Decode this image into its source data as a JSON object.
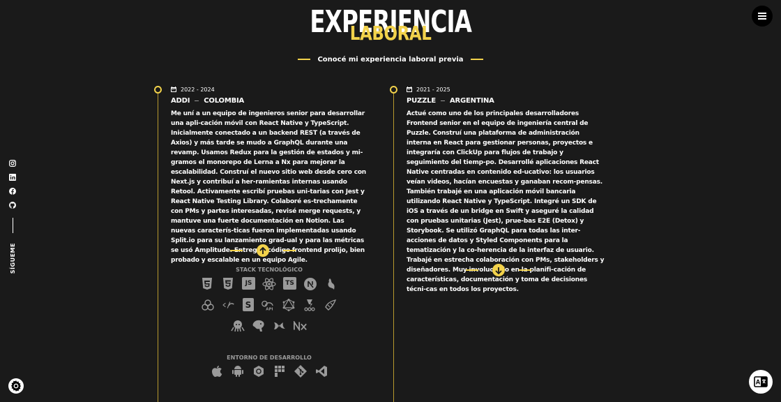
{
  "header": {
    "title": "EXPERIENCIA",
    "title_accent": "LABORAL",
    "subtitle": "Conocé mi experiencia laboral previa"
  },
  "social": {
    "follow_label": "SÍGUEME",
    "icons": [
      "instagram-icon",
      "linkedin-icon",
      "facebook-icon",
      "github-icon"
    ]
  },
  "experiences": [
    {
      "date": "2022 - 2024",
      "company": "ADDI",
      "country": "COLOMBIA",
      "description": "Me uní a un equipo de ingenieros senior para desarrollar una apli-cación móvil con React Native y TypeScript. Inicialmente conectado a un backend REST (a través de Axios) y más tarde se mudo a GraphQL durante una revamp. Usamos Redux para la gestión de estados y mi-gramos el monorepo de Lerna a Nx para mejorar la escalabilidad. Construí el nuevo sitio web desde cero con Next.js y contribuí a her-ramientas internas usando Retool. Activamente escribí pruebas uni-tarias con Jest y React Native Testing Library. Colaboré es-trechamente con PMs y partes interesadas, revisé merge requests, y mantuve una fuerte documentación en Notion. Las nuevas caracterís-ticas fueron implementadas usando Split.io para su lanzamiento grad-ual y para las métricas se usó Amplitude. Entregué código frontend prolijo, bien probado y escalable en un equipo Agile."
    },
    {
      "date": "2021 - 2025",
      "company": "PUZZLE",
      "country": "ARGENTINA",
      "description": "Actué como uno de los principales desarrolladores Frontend senior en el equipo de ingeniería central de Puzzle. Construí una plataforma de administración interna en React para gestionar personas, proyectos e integraría con ClickUp para flujos de trabajo y seguimiento del tiemp-po. Desarrollé aplicaciones React Native centradas en contenido ed-ucativo: los usuarios veían videos, hacían encuestas y ganaban recom-pensas. También trabajé en una aplicación móvil bancaria utilizando React Native y TypeScript. Integré un SDK de iOS a través de un bridge en Swift y aseguré la calidad con pruebas unitarias (Jest), prue-bas E2E (Detox) y Storybook. Se utilizó GraphQL para todas las inter-acciones de datos y Styled Components para la tematización y la co-herencia de la interfaz de usuario. Trabajé en estrecha colaboración con PMs, stakeholders y diseñadores. Muy involucrado en la planifi-cación de características, documentación y toma de decisiones técni-cas en todos los proyectos."
    }
  ],
  "stack": {
    "label": "STACK TECNOLÓGICO",
    "icons": [
      "html5-icon",
      "css3-icon",
      "javascript-icon",
      "react-icon",
      "typescript-icon",
      "nextjs-icon",
      "nestjs-icon",
      "redux-icon",
      "graphql-client-icon",
      "storybook-icon",
      "api-icon",
      "graphql-icon",
      "jest-icon",
      "styled-components-icon",
      "octopus-icon",
      "postgresql-icon",
      "phoenix-icon",
      "nx-icon"
    ]
  },
  "dev_env": {
    "label": "ENTORNO DE DESARROLLO",
    "icons": [
      "apple-icon",
      "android-icon",
      "chrome-icon",
      "pnpm-icon",
      "git-icon",
      "vscode-icon"
    ]
  },
  "colors": {
    "accent": "#f2d24b",
    "background": "#1a1a1a",
    "muted": "#9a9a9a"
  }
}
